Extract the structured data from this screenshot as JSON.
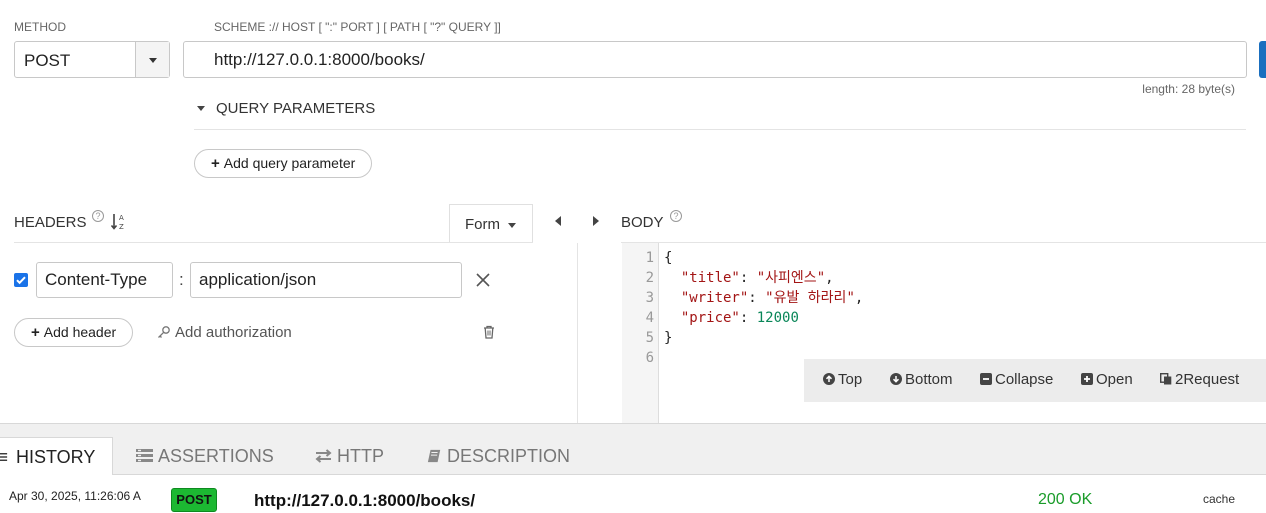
{
  "request": {
    "method_caption": "METHOD",
    "method": "POST",
    "url_caption": "SCHEME :// HOST [ \":\" PORT ] [ PATH [ \"?\" QUERY ]]",
    "url": "http://127.0.0.1:8000/books/",
    "length": "length: 28 byte(s)"
  },
  "query": {
    "section_label": "QUERY PARAMETERS",
    "add_label": "Add query parameter"
  },
  "headers": {
    "label": "HEADERS",
    "form_label": "Form",
    "items": [
      {
        "name": "Content-Type",
        "value": "application/json",
        "enabled": true
      }
    ],
    "add_header_label": "Add header",
    "add_auth_label": "Add authorization"
  },
  "body": {
    "label": "BODY",
    "line_numbers": [
      "1",
      "2",
      "3",
      "4",
      "5",
      "6"
    ],
    "json": {
      "title": "사피엔스",
      "writer": "유발 하라리",
      "price": 12000
    },
    "toolbar": {
      "top": "Top",
      "bottom": "Bottom",
      "collapse": "Collapse",
      "open": "Open",
      "request": "2Request"
    }
  },
  "tabs": [
    {
      "label": "HISTORY",
      "icon": "list-icon",
      "active": true
    },
    {
      "label": "ASSERTIONS",
      "icon": "assertions-icon",
      "active": false
    },
    {
      "label": "HTTP",
      "icon": "exchange-icon",
      "active": false
    },
    {
      "label": "DESCRIPTION",
      "icon": "book-icon",
      "active": false
    }
  ],
  "history": [
    {
      "date": "Apr 30, 2025, 11:26:06 A",
      "method": "POST",
      "url": "http://127.0.0.1:8000/books/",
      "status": "200 OK",
      "cache": "cache"
    }
  ],
  "colors": {
    "accent": "#1a73e8",
    "post_badge": "#1cb832",
    "status_ok": "#1a9c2a",
    "json_string": "#a31515",
    "json_number": "#098658"
  }
}
